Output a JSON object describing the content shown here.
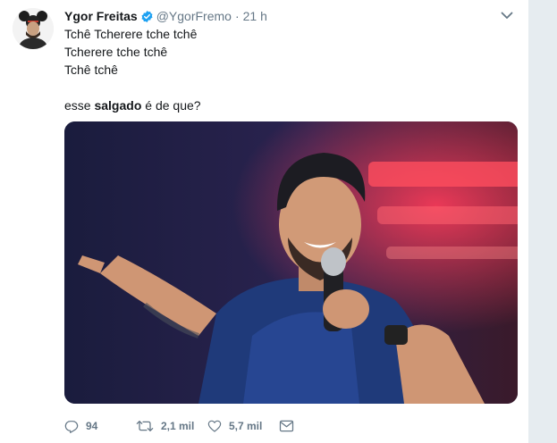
{
  "tweet": {
    "author_name": "Ygor Freitas",
    "handle": "@YgorFremo",
    "separator": "·",
    "time": "21 h",
    "text_lines": [
      "Tchê Tcherere tche tchê",
      "Tcherere tche tchê",
      "Tchê tchê"
    ],
    "question_before": "esse ",
    "question_bold": "salgado",
    "question_after": " é de que?",
    "photo_icon": "stage-performer-photo"
  },
  "actions": {
    "reply_count": "94",
    "retweet_count": "2,1 mil",
    "like_count": "5,7 mil"
  },
  "icons": {
    "verified": "verified-badge-icon",
    "caret": "chevron-down-icon",
    "reply": "reply-icon",
    "retweet": "retweet-icon",
    "like": "heart-icon",
    "dm": "envelope-icon"
  },
  "colors": {
    "verified": "#1da1f2",
    "text": "#14171a",
    "muted": "#657786",
    "background": "#e6ecf0"
  }
}
